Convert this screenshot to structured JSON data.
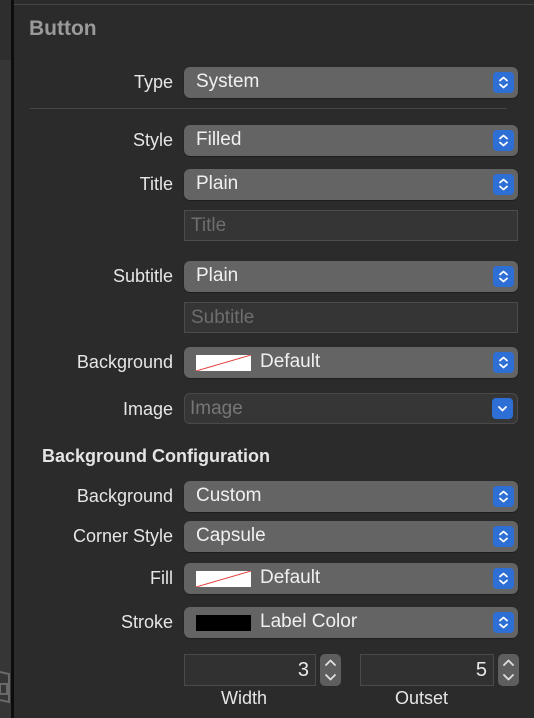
{
  "section": {
    "title": "Button"
  },
  "type_row": {
    "label": "Type",
    "value": "System"
  },
  "style_row": {
    "label": "Style",
    "value": "Filled"
  },
  "title_row": {
    "label": "Title",
    "value": "Plain",
    "field_placeholder": "Title",
    "field_value": ""
  },
  "subtitle_row": {
    "label": "Subtitle",
    "value": "Plain",
    "field_placeholder": "Subtitle",
    "field_value": ""
  },
  "background_row": {
    "label": "Background",
    "value": "Default",
    "swatch": "none"
  },
  "image_row": {
    "label": "Image",
    "placeholder": "Image"
  },
  "background_configuration": {
    "title": "Background Configuration",
    "background": {
      "label": "Background",
      "value": "Custom"
    },
    "corner_style": {
      "label": "Corner Style",
      "value": "Capsule"
    },
    "fill": {
      "label": "Fill",
      "value": "Default",
      "swatch": "none"
    },
    "stroke": {
      "label": "Stroke",
      "value": "Label Color",
      "swatch_color": "#000000"
    },
    "width": {
      "label": "Width",
      "value": "3"
    },
    "outset": {
      "label": "Outset",
      "value": "5"
    }
  },
  "colors": {
    "accent": "#2e6fd6",
    "panel_bg": "#2b2b2b",
    "popup_bg": "#646464",
    "none_slash": "#e0403a"
  }
}
